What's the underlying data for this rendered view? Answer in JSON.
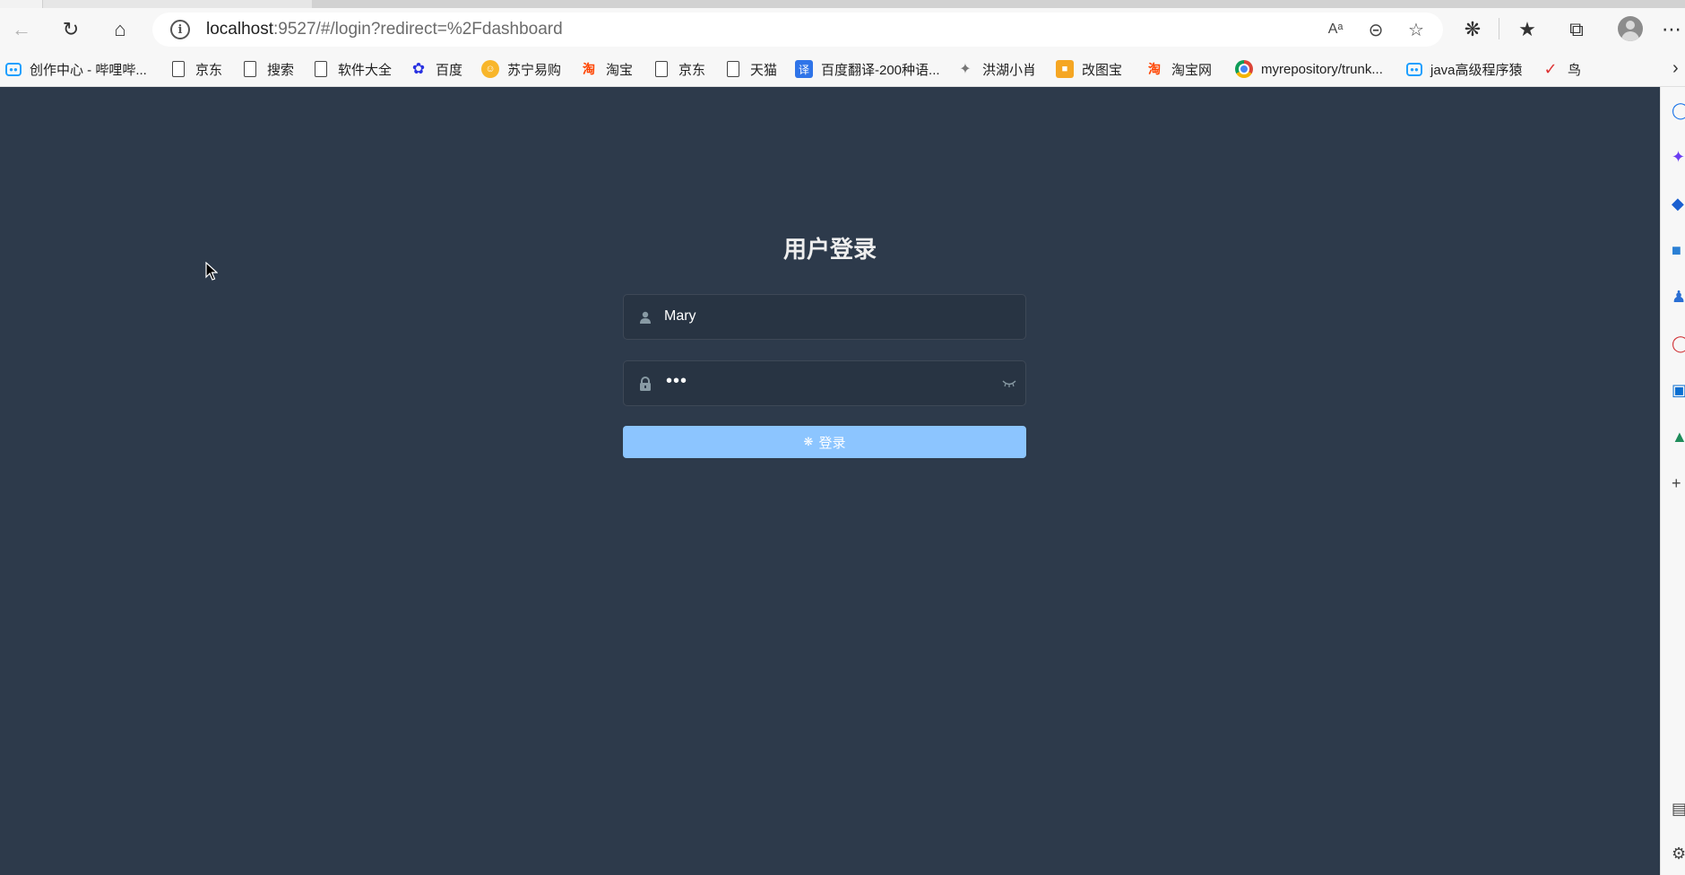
{
  "browser": {
    "address_host": "localhost",
    "address_rest": ":9527/#/login?redirect=%2Fdashboard",
    "bookmarks": [
      {
        "label": "创作中心 - 哔哩哔...",
        "icon": "bilibili-icon"
      },
      {
        "label": "京东",
        "icon": "page-icon"
      },
      {
        "label": "搜索",
        "icon": "page-icon"
      },
      {
        "label": "软件大全",
        "icon": "page-icon"
      },
      {
        "label": "百度",
        "icon": "baidu-icon"
      },
      {
        "label": "苏宁易购",
        "icon": "suning-icon"
      },
      {
        "label": "淘宝",
        "icon": "taobao-icon"
      },
      {
        "label": "京东",
        "icon": "page-icon"
      },
      {
        "label": "天猫",
        "icon": "page-icon"
      },
      {
        "label": "百度翻译-200种语...",
        "icon": "fanyi-icon"
      },
      {
        "label": "洪湖小肖",
        "icon": "eagle-icon"
      },
      {
        "label": "改图宝",
        "icon": "gaitu-icon"
      },
      {
        "label": "淘宝网",
        "icon": "taobao-icon"
      },
      {
        "label": "myrepository/trunk...",
        "icon": "chrome-icon"
      },
      {
        "label": "java高级程序猿",
        "icon": "bilibili-icon"
      },
      {
        "label": "鸟",
        "icon": "bird-icon"
      }
    ]
  },
  "login": {
    "title": "用户登录",
    "username_value": "Mary",
    "password_mask": "•••",
    "login_button_label": "登录"
  },
  "colors": {
    "page_background": "#2d3a4b",
    "button_loading": "#8cc5ff",
    "title_text": "#eeeeee",
    "icon_gray": "#889aa4"
  }
}
